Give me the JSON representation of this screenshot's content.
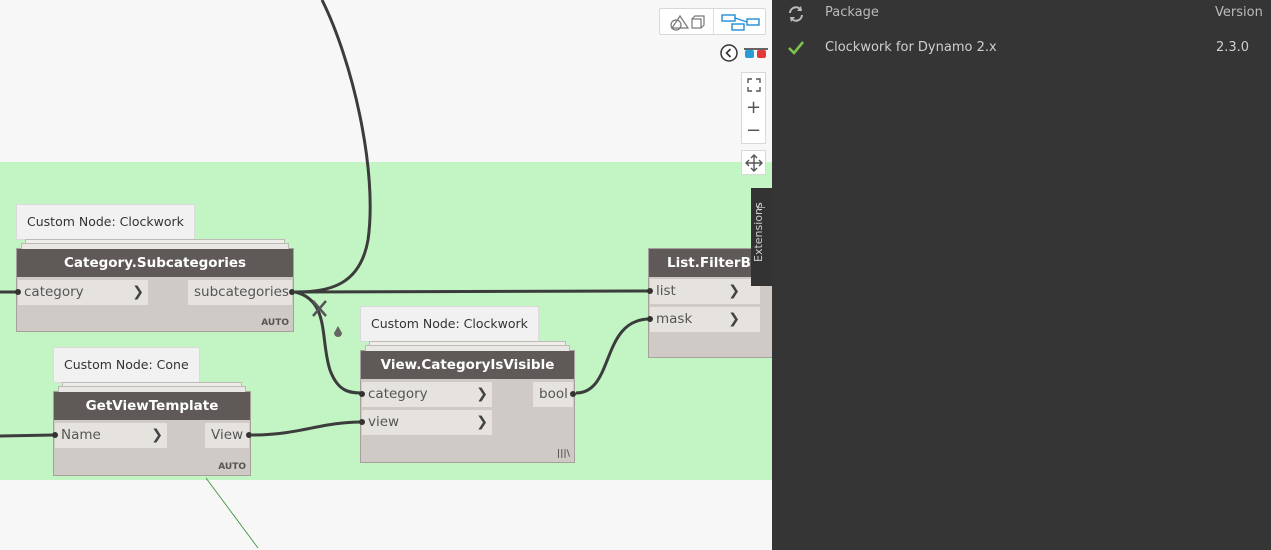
{
  "graph": {
    "nodes": {
      "subcategories": {
        "tooltip": "Custom Node: Clockwork",
        "title": "Category.Subcategories",
        "input": "category",
        "output": "subcategories",
        "lacing": "AUTO"
      },
      "viewtemplate": {
        "tooltip": "Custom Node: Cone",
        "title": "GetViewTemplate",
        "input": "Name",
        "output": "View",
        "lacing": "AUTO"
      },
      "isvisible": {
        "tooltip": "Custom Node: Clockwork",
        "title": "View.CategoryIsVisible",
        "input1": "category",
        "input2": "view",
        "output": "bool",
        "lacing": "|||\\"
      },
      "filter": {
        "title": "List.FilterByBoolMask",
        "input1": "list",
        "input2": "mask"
      }
    }
  },
  "navigation": {
    "view_toggle_icons": [
      "geometry-view-icon",
      "graph-view-icon"
    ],
    "buttons": [
      "back-icon",
      "3d-glasses-icon",
      "zoom-fit-icon",
      "zoom-in-icon",
      "zoom-out-icon",
      "pan-icon"
    ]
  },
  "extensions_tab": {
    "label": "Extensions"
  },
  "package_panel": {
    "col_package": "Package",
    "col_version": "Version",
    "rows": [
      {
        "name": "Clockwork for Dynamo 2.x",
        "version": "2.3.0",
        "status": "installed"
      }
    ],
    "accent": "#7ec24a"
  }
}
